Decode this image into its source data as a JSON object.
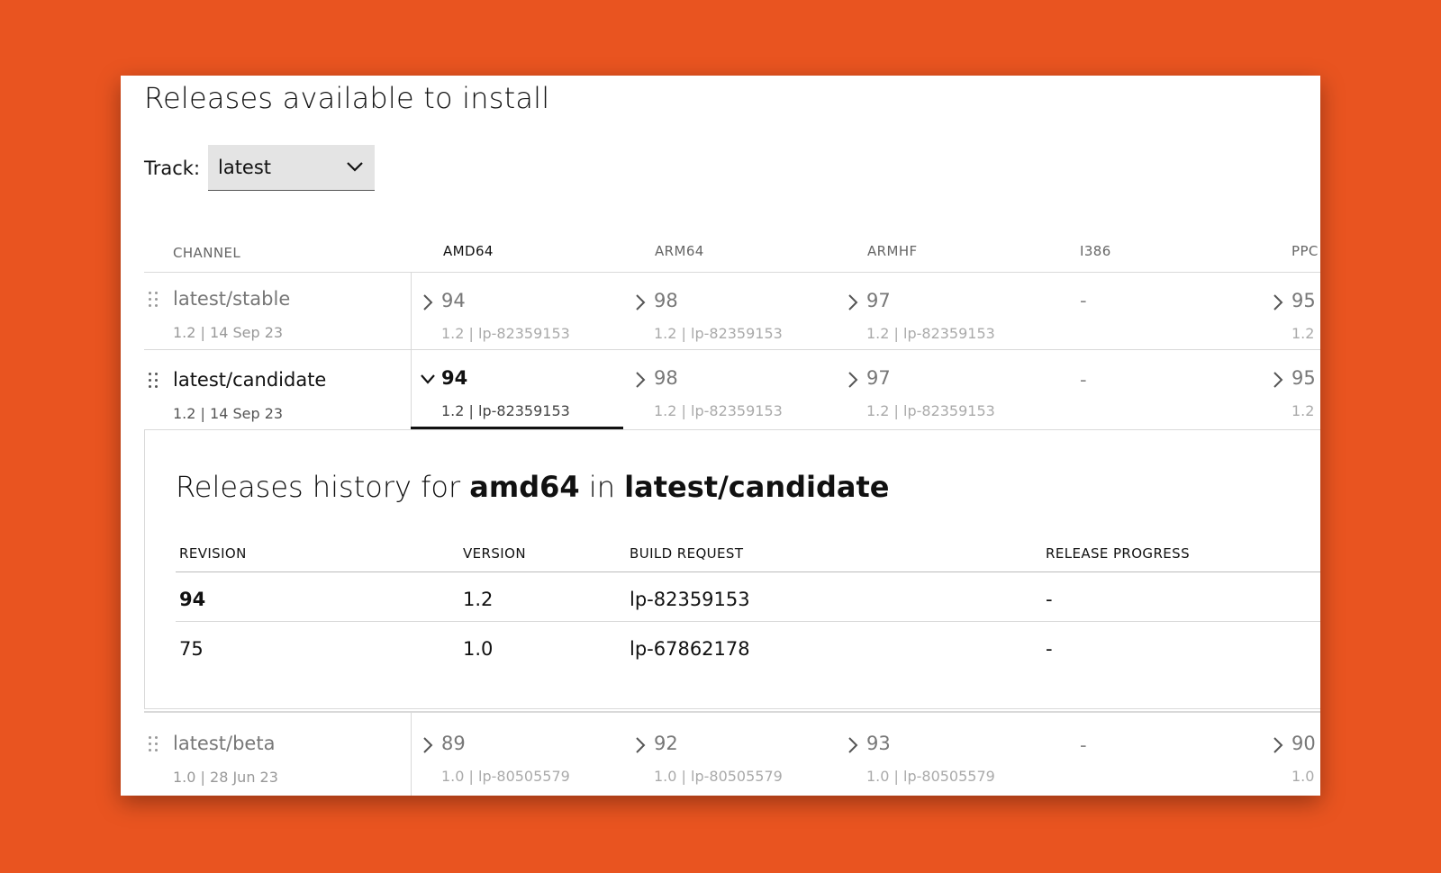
{
  "page": {
    "title": "Releases available to install"
  },
  "track": {
    "label": "Track:",
    "value": "latest"
  },
  "table": {
    "channel_header": "CHANNEL",
    "arch_headers": [
      "AMD64",
      "ARM64",
      "ARMHF",
      "I386",
      "PPC"
    ],
    "rows": [
      {
        "name": "latest/stable",
        "meta": "1.2 | 14 Sep 23",
        "cells": [
          {
            "rev": "94",
            "meta": "1.2 | lp-82359153"
          },
          {
            "rev": "98",
            "meta": "1.2 | lp-82359153"
          },
          {
            "rev": "97",
            "meta": "1.2 | lp-82359153"
          },
          {
            "rev": "-"
          },
          {
            "rev": "95",
            "meta": "1.2 |"
          }
        ]
      },
      {
        "name": "latest/candidate",
        "meta": "1.2 | 14 Sep 23",
        "cells": [
          {
            "rev": "94",
            "meta": "1.2 | lp-82359153"
          },
          {
            "rev": "98",
            "meta": "1.2 | lp-82359153"
          },
          {
            "rev": "97",
            "meta": "1.2 | lp-82359153"
          },
          {
            "rev": "-"
          },
          {
            "rev": "95",
            "meta": "1.2 |"
          }
        ]
      },
      {
        "name": "latest/beta",
        "meta": "1.0 | 28 Jun 23",
        "cells": [
          {
            "rev": "89",
            "meta": "1.0 | lp-80505579"
          },
          {
            "rev": "92",
            "meta": "1.0 | lp-80505579"
          },
          {
            "rev": "93",
            "meta": "1.0 | lp-80505579"
          },
          {
            "rev": "-"
          },
          {
            "rev": "90",
            "meta": "1.0 |"
          }
        ]
      }
    ]
  },
  "history": {
    "title_prefix": "Releases history for",
    "arch": "amd64",
    "title_mid": "in",
    "channel": "latest/candidate",
    "columns": [
      "REVISION",
      "VERSION",
      "BUILD REQUEST",
      "RELEASE PROGRESS"
    ],
    "rows": [
      {
        "revision": "94",
        "version": "1.2",
        "build": "lp-82359153",
        "progress": "-"
      },
      {
        "revision": "75",
        "version": "1.0",
        "build": "lp-67862178",
        "progress": "-"
      }
    ]
  },
  "colors": {
    "background": "#E95420",
    "panel": "#FFFFFF",
    "selected_underline": "#111111"
  }
}
